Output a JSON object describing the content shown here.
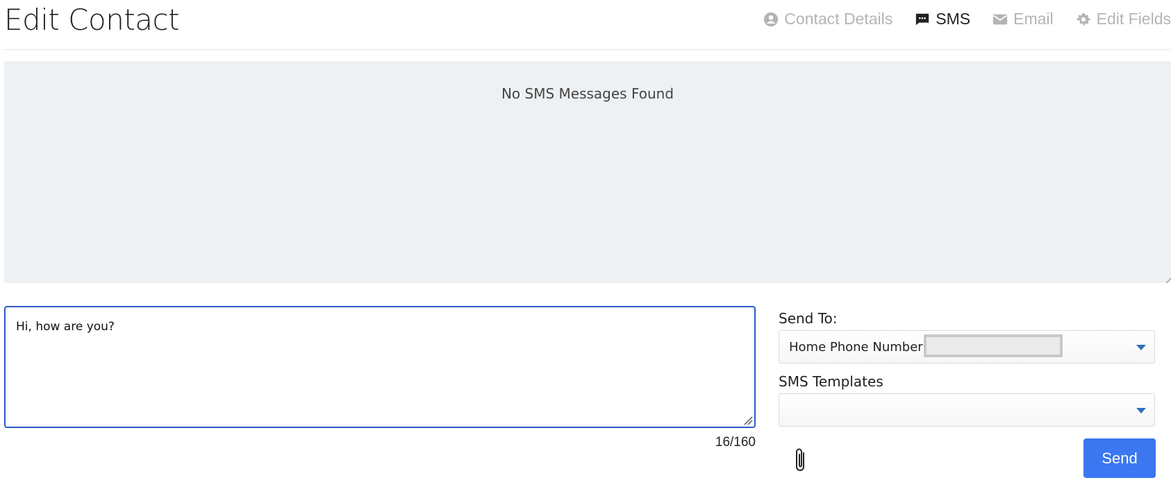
{
  "page": {
    "title": "Edit Contact"
  },
  "tabs": [
    {
      "label": "Contact Details",
      "icon": "person-circle-icon",
      "active": false
    },
    {
      "label": "SMS",
      "icon": "chat-bubble-icon",
      "active": true
    },
    {
      "label": "Email",
      "icon": "envelope-icon",
      "active": false
    },
    {
      "label": "Edit Fields",
      "icon": "gear-icon",
      "active": false
    }
  ],
  "messages": {
    "empty_text": "No SMS Messages Found"
  },
  "composer": {
    "text": "Hi, how are you?",
    "counter": "16/160"
  },
  "send_to": {
    "label": "Send To:",
    "value": "Home Phone Number -"
  },
  "templates": {
    "label": "SMS Templates",
    "value": ""
  },
  "actions": {
    "send_label": "Send",
    "attach_icon": "paperclip-icon"
  },
  "colors": {
    "accent": "#3b77f0",
    "focus_border": "#2c5bc8",
    "panel_bg": "#eef1f3",
    "inactive_tab": "#b4b4b4"
  }
}
